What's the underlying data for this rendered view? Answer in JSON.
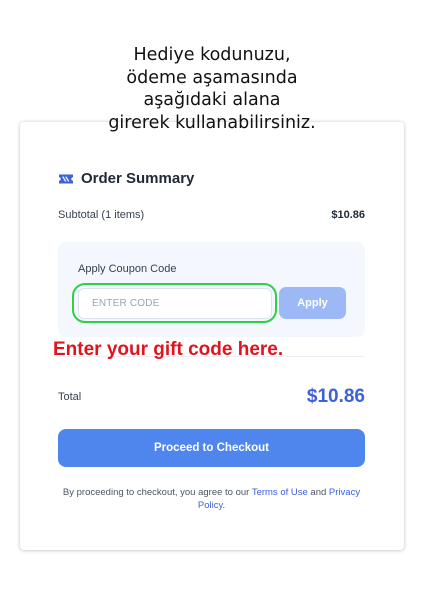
{
  "overlay": {
    "instruction_lines": [
      "Hediye kodunuzu,",
      "ödeme aşamasında",
      "aşağıdaki alana",
      "girerek kullanabilirsiniz."
    ],
    "annotation": "Enter your gift code here.",
    "annotation_color": "#e0141e",
    "highlight_color": "#2fcf4a"
  },
  "summary": {
    "icon": "ticket-icon",
    "title": "Order Summary",
    "subtotal_label": "Subtotal (1 items)",
    "subtotal_amount": "$10.86"
  },
  "coupon": {
    "label": "Apply Coupon Code",
    "placeholder": "ENTER CODE",
    "value": "",
    "apply_label": "Apply"
  },
  "total": {
    "label": "Total",
    "amount": "$10.86"
  },
  "checkout": {
    "button_label": "Proceed to Checkout",
    "terms_prefix": "By proceeding to checkout, you agree to our ",
    "terms_link": "Terms of Use",
    "terms_middle": " and ",
    "privacy_link": "Privacy Policy",
    "terms_suffix": "."
  },
  "colors": {
    "primary": "#4f86ee",
    "apply_disabled": "#9db9f5",
    "total_accent": "#3b62d8"
  }
}
